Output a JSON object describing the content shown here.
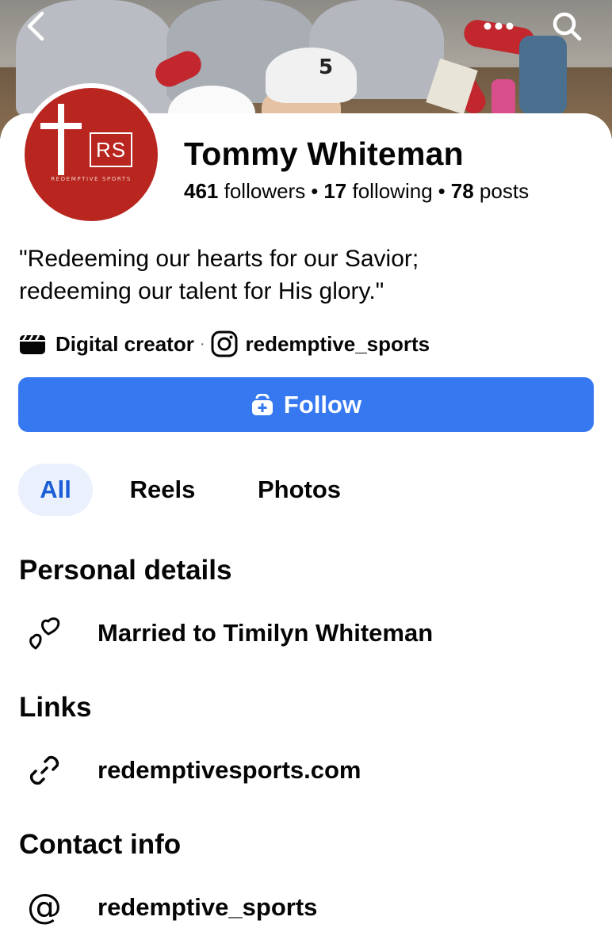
{
  "profile": {
    "name": "Tommy Whiteman",
    "followers_count": "461",
    "followers_label": "followers",
    "following_count": "17",
    "following_label": "following",
    "posts_count": "78",
    "posts_label": "posts",
    "bio_line1": "\"Redeeming our hearts for our Savior;",
    "bio_line2": "redeeming our talent for His glory.\"",
    "category": "Digital creator",
    "instagram_handle": "redemptive_sports",
    "avatar_logo_text": "RS",
    "avatar_logo_subtext": "REDEMPTIVE SPORTS",
    "cover_cap_number": "5"
  },
  "actions": {
    "follow_label": "Follow"
  },
  "tabs": [
    {
      "label": "All",
      "active": true
    },
    {
      "label": "Reels",
      "active": false
    },
    {
      "label": "Photos",
      "active": false
    }
  ],
  "sections": {
    "personal_details": {
      "title": "Personal details",
      "relationship": "Married to Timilyn Whiteman"
    },
    "links": {
      "title": "Links",
      "website": "redemptivesports.com"
    },
    "contact_info": {
      "title": "Contact info",
      "instagram": "redemptive_sports"
    }
  },
  "icons": {
    "back": "chevron-left-icon",
    "more": "more-horizontal-icon",
    "search": "search-icon",
    "category": "clapperboard-icon",
    "instagram": "instagram-icon",
    "follow": "add-friend-icon",
    "relationship": "hearts-icon",
    "link": "link-icon",
    "contact": "at-sign-icon"
  },
  "colors": {
    "accent": "#3578f0",
    "tab_active_bg": "#eaf1fd",
    "tab_active_text": "#1a5dd6",
    "avatar_red": "#b8261f",
    "text": "#050505"
  }
}
